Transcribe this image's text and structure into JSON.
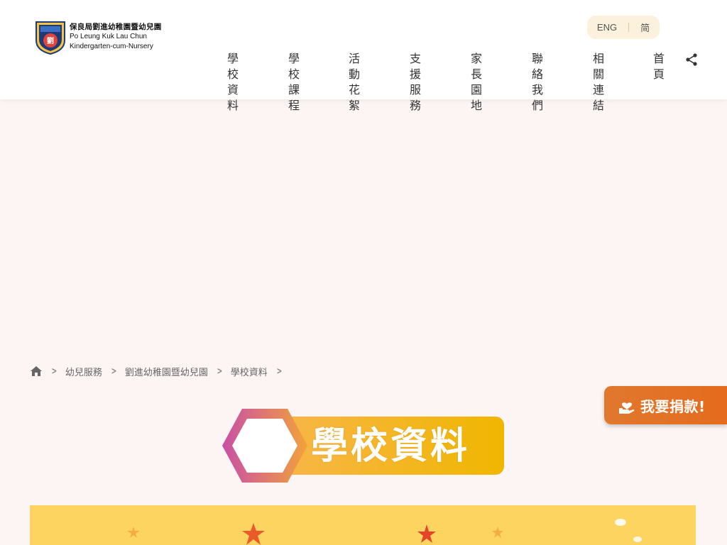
{
  "header": {
    "logo_zh": "保良局劉進幼稚園暨幼兒園",
    "logo_en_line1": "Po Leung Kuk Lau Chun",
    "logo_en_line2": "Kindergarten-cum-Nursery",
    "lang_eng": "ENG",
    "lang_simplified": "简"
  },
  "nav": {
    "items": [
      {
        "line1": "學校資",
        "line2": "料"
      },
      {
        "line1": "學校課",
        "line2": "程"
      },
      {
        "line1": "活動花",
        "line2": "絮"
      },
      {
        "line1": "支援服",
        "line2": "務"
      },
      {
        "line1": "家長園",
        "line2": "地"
      },
      {
        "line1": "聯絡我",
        "line2": "們"
      },
      {
        "line1": "相關連",
        "line2": "結"
      },
      {
        "line1": "首",
        "line2": "頁"
      }
    ]
  },
  "breadcrumb": {
    "items": [
      "幼兒服務",
      "劉進幼稚園暨幼兒園",
      "學校資料"
    ]
  },
  "donate": {
    "label": "我要捐款!"
  },
  "page_title": "學校資料",
  "colors": {
    "accent_orange": "#e56b1d",
    "banner_yellow": "#fcd45f",
    "hexagon_gradient_start": "#c94fa6",
    "hexagon_gradient_end": "#f2a23a"
  }
}
